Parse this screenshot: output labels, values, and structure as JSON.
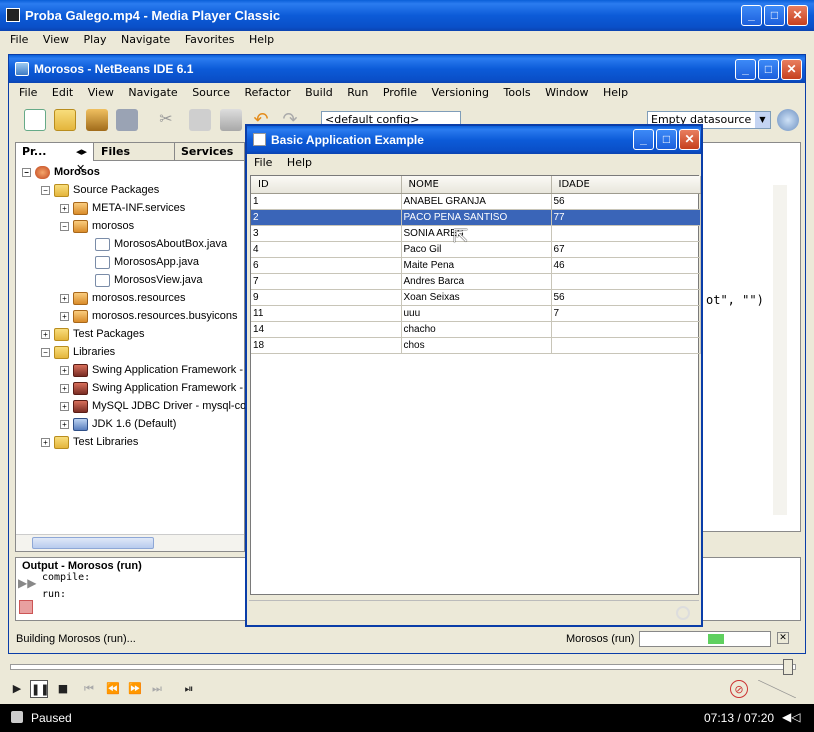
{
  "mpc": {
    "title": "Proba Galego.mp4 - Media Player Classic",
    "menu": [
      "File",
      "View",
      "Play",
      "Navigate",
      "Favorites",
      "Help"
    ],
    "status": "Paused",
    "time": "07:13 / 07:20"
  },
  "nb": {
    "title": "Morosos - NetBeans IDE 6.1",
    "menu": [
      "File",
      "Edit",
      "View",
      "Navigate",
      "Source",
      "Refactor",
      "Build",
      "Run",
      "Profile",
      "Versioning",
      "Tools",
      "Window",
      "Help"
    ],
    "config": "<default config>",
    "datasource": "Empty datasource",
    "tabs": {
      "projects": "Pr...",
      "files": "Files",
      "services": "Services"
    },
    "tree": [
      {
        "label": "Morosos"
      },
      {
        "label": "Source Packages"
      },
      {
        "label": "META-INF.services"
      },
      {
        "label": "morosos"
      },
      {
        "label": "MorososAboutBox.java"
      },
      {
        "label": "MorososApp.java"
      },
      {
        "label": "MorososView.java"
      },
      {
        "label": "morosos.resources"
      },
      {
        "label": "morosos.resources.busyicons"
      },
      {
        "label": "Test Packages"
      },
      {
        "label": "Libraries"
      },
      {
        "label": "Swing Application Framework -"
      },
      {
        "label": "Swing Application Framework -"
      },
      {
        "label": "MySQL JDBC Driver - mysql-co"
      },
      {
        "label": "JDK 1.6 (Default)"
      },
      {
        "label": "Test Libraries"
      }
    ],
    "code_fragment": "ot\", \"\")",
    "output_title": "Output - Morosos (run)",
    "output_lines": [
      "compile:",
      "run:"
    ],
    "status_left": "Building Morosos (run)...",
    "status_right": "Morosos (run)"
  },
  "app": {
    "title": "Basic Application Example",
    "menu": [
      "File",
      "Help"
    ],
    "columns": [
      "ID",
      "NOME",
      "IDADE"
    ],
    "rows": [
      [
        "1",
        "ANABEL GRANJA",
        "56"
      ],
      [
        "2",
        "PACO PENA SANTISO",
        "77"
      ],
      [
        "3",
        "SONIA ARES",
        ""
      ],
      [
        "4",
        "Paco Gil",
        "67"
      ],
      [
        "6",
        "Maite Pena",
        "46"
      ],
      [
        "7",
        "Andres Barca",
        ""
      ],
      [
        "9",
        "Xoan Seixas",
        "56"
      ],
      [
        "11",
        "uuu",
        "7"
      ],
      [
        "14",
        "chacho",
        ""
      ],
      [
        "18",
        "chos",
        ""
      ]
    ],
    "selected_row": 1
  }
}
